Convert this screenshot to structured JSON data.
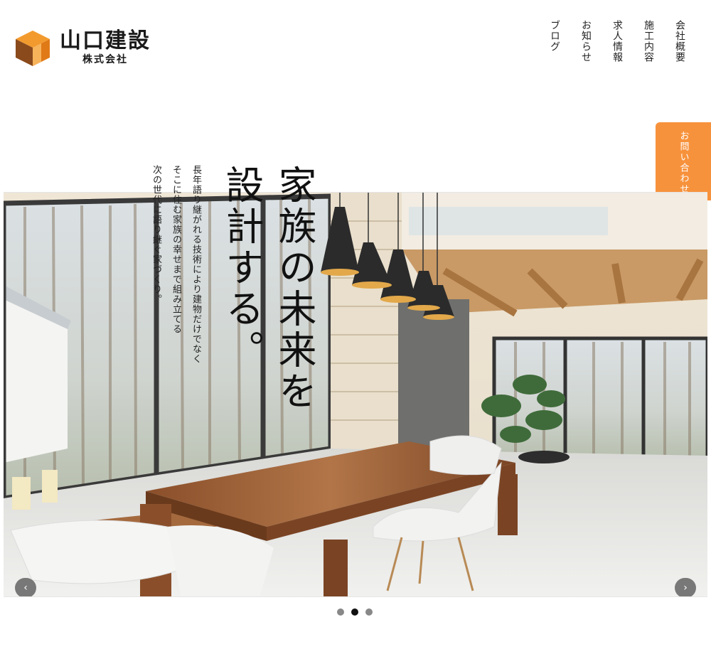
{
  "brand": {
    "name": "山口建設",
    "sub": "株式会社"
  },
  "nav": {
    "items": [
      {
        "label": "会社概要"
      },
      {
        "label": "施工内容"
      },
      {
        "label": "求人情報"
      },
      {
        "label": "お知らせ"
      },
      {
        "label": "ブログ"
      }
    ]
  },
  "contact": {
    "label": "お問い合わせ"
  },
  "hero": {
    "headline": [
      "家族の未来を",
      "設計する。"
    ],
    "tagline": [
      "長年語り継がれる技術により建物だけでなく",
      "そこに住む家族の幸せまで組み立てる",
      "次の世代に語り継ぐ家づくり。"
    ]
  },
  "slider": {
    "prev_icon": "chevron-left-icon",
    "next_icon": "chevron-right-icon",
    "prev_label": "‹",
    "next_label": "›",
    "slide_count": 3,
    "active_slide": 2
  },
  "colors": {
    "accent": "#f7923c",
    "logo_orange": "#f39a2e",
    "logo_brown": "#8a4a1c"
  }
}
